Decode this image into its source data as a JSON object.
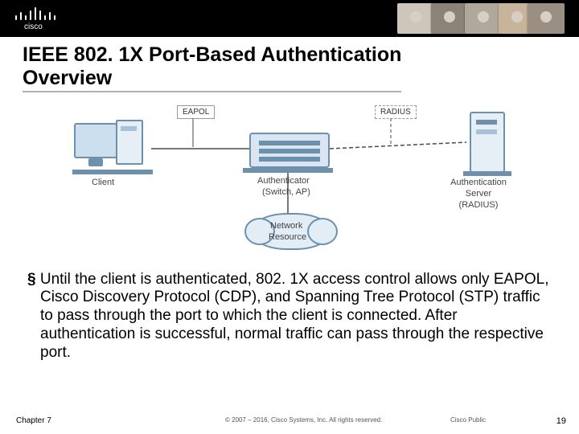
{
  "branding": {
    "logo_text": "cisco"
  },
  "slide": {
    "title_line1": "IEEE 802. 1X Port-Based Authentication",
    "title_line2": "Overview"
  },
  "diagram": {
    "client_label": "Client",
    "authenticator_label1": "Authenticator",
    "authenticator_label2": "(Switch, AP)",
    "auth_server_label1": "Authentication",
    "auth_server_label2": "Server",
    "auth_server_label3": "(RADIUS)",
    "network_resource_label1": "Network",
    "network_resource_label2": "Resource",
    "proto_left": "EAPOL",
    "proto_right": "RADIUS"
  },
  "bullet": {
    "marker": "§",
    "text": "Until the client is authenticated, 802. 1X access control allows only EAPOL, Cisco Discovery Protocol (CDP), and Spanning Tree Protocol (STP) traffic to pass through the port to which the client is connected. After authentication is successful, normal traffic can pass through the respective port."
  },
  "footer": {
    "chapter": "Chapter 7",
    "copyright": "© 2007 – 2016, Cisco Systems, Inc. All rights reserved.",
    "classification": "Cisco Public",
    "page_number": "19"
  }
}
